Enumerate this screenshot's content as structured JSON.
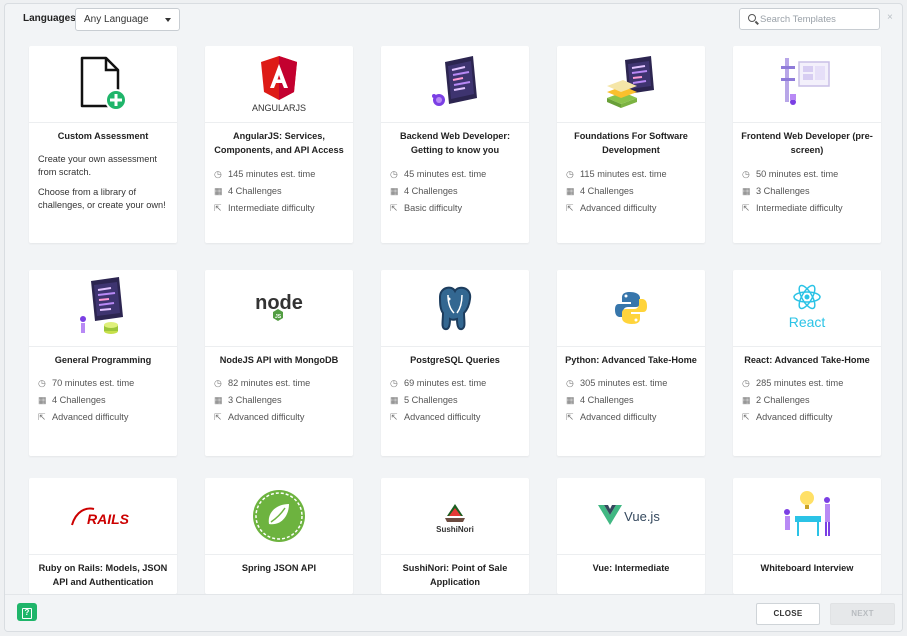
{
  "toolbar": {
    "languages_label": "Languages:",
    "language_selected": "Any Language",
    "search_placeholder": "Search Templates",
    "search_value": "",
    "clear_icon": "×"
  },
  "cards": [
    {
      "title": "Custom Assessment",
      "desc1": "Create your own assessment from scratch.",
      "desc2": "Choose from a library of challenges, or create your own!",
      "logo": "new-file-icon"
    },
    {
      "title": "AngularJS: Services, Components, and API Access",
      "time": "145 minutes est. time",
      "challenges": "4 Challenges",
      "difficulty": "Intermediate difficulty",
      "logo": "angularjs-logo",
      "logo_text": "ANGULARJS"
    },
    {
      "title": "Backend Web Developer: Getting to know you",
      "time": "45 minutes est. time",
      "challenges": "4 Challenges",
      "difficulty": "Basic difficulty",
      "logo": "backend-illustration"
    },
    {
      "title": "Foundations For Software Development",
      "time": "115 minutes est. time",
      "challenges": "4 Challenges",
      "difficulty": "Advanced difficulty",
      "logo": "foundations-illustration"
    },
    {
      "title": "Frontend Web Developer (pre-screen)",
      "time": "50 minutes est. time",
      "challenges": "3 Challenges",
      "difficulty": "Intermediate difficulty",
      "logo": "frontend-illustration"
    },
    {
      "title": "General Programming",
      "time": "70 minutes est. time",
      "challenges": "4 Challenges",
      "difficulty": "Advanced difficulty",
      "logo": "programming-illustration"
    },
    {
      "title": "NodeJS API with MongoDB",
      "time": "82 minutes est. time",
      "challenges": "3 Challenges",
      "difficulty": "Advanced difficulty",
      "logo": "nodejs-logo",
      "logo_text": "node",
      "logo_badge": "JS"
    },
    {
      "title": "PostgreSQL Queries",
      "time": "69 minutes est. time",
      "challenges": "5 Challenges",
      "difficulty": "Advanced difficulty",
      "logo": "postgresql-logo"
    },
    {
      "title": "Python: Advanced Take-Home",
      "time": "305 minutes est. time",
      "challenges": "4 Challenges",
      "difficulty": "Advanced difficulty",
      "logo": "python-logo"
    },
    {
      "title": "React: Advanced Take-Home",
      "time": "285 minutes est. time",
      "challenges": "2 Challenges",
      "difficulty": "Advanced difficulty",
      "logo": "react-logo",
      "logo_text": "React"
    },
    {
      "title": "Ruby on Rails: Models, JSON API and Authentication",
      "logo": "rails-logo",
      "logo_text": "RAILS"
    },
    {
      "title": "Spring JSON API",
      "logo": "spring-logo"
    },
    {
      "title": "SushiNori: Point of Sale Application",
      "logo": "sushinori-logo",
      "logo_text": "SushiNori"
    },
    {
      "title": "Vue: Intermediate",
      "logo": "vue-logo",
      "logo_text": "Vue.js"
    },
    {
      "title": "Whiteboard Interview",
      "logo": "whiteboard-illustration"
    }
  ],
  "footer": {
    "help_icon": "?",
    "close_label": "CLOSE",
    "next_label": "NEXT"
  },
  "colors": {
    "green": "#1fb56a",
    "angular_red": "#dd1b16",
    "node_green": "#539e43",
    "react_cyan": "#2bc3e6",
    "rails_red": "#cc0000",
    "vue_green": "#41b883",
    "vue_dark": "#35495e",
    "postgres_blue": "#336791"
  }
}
